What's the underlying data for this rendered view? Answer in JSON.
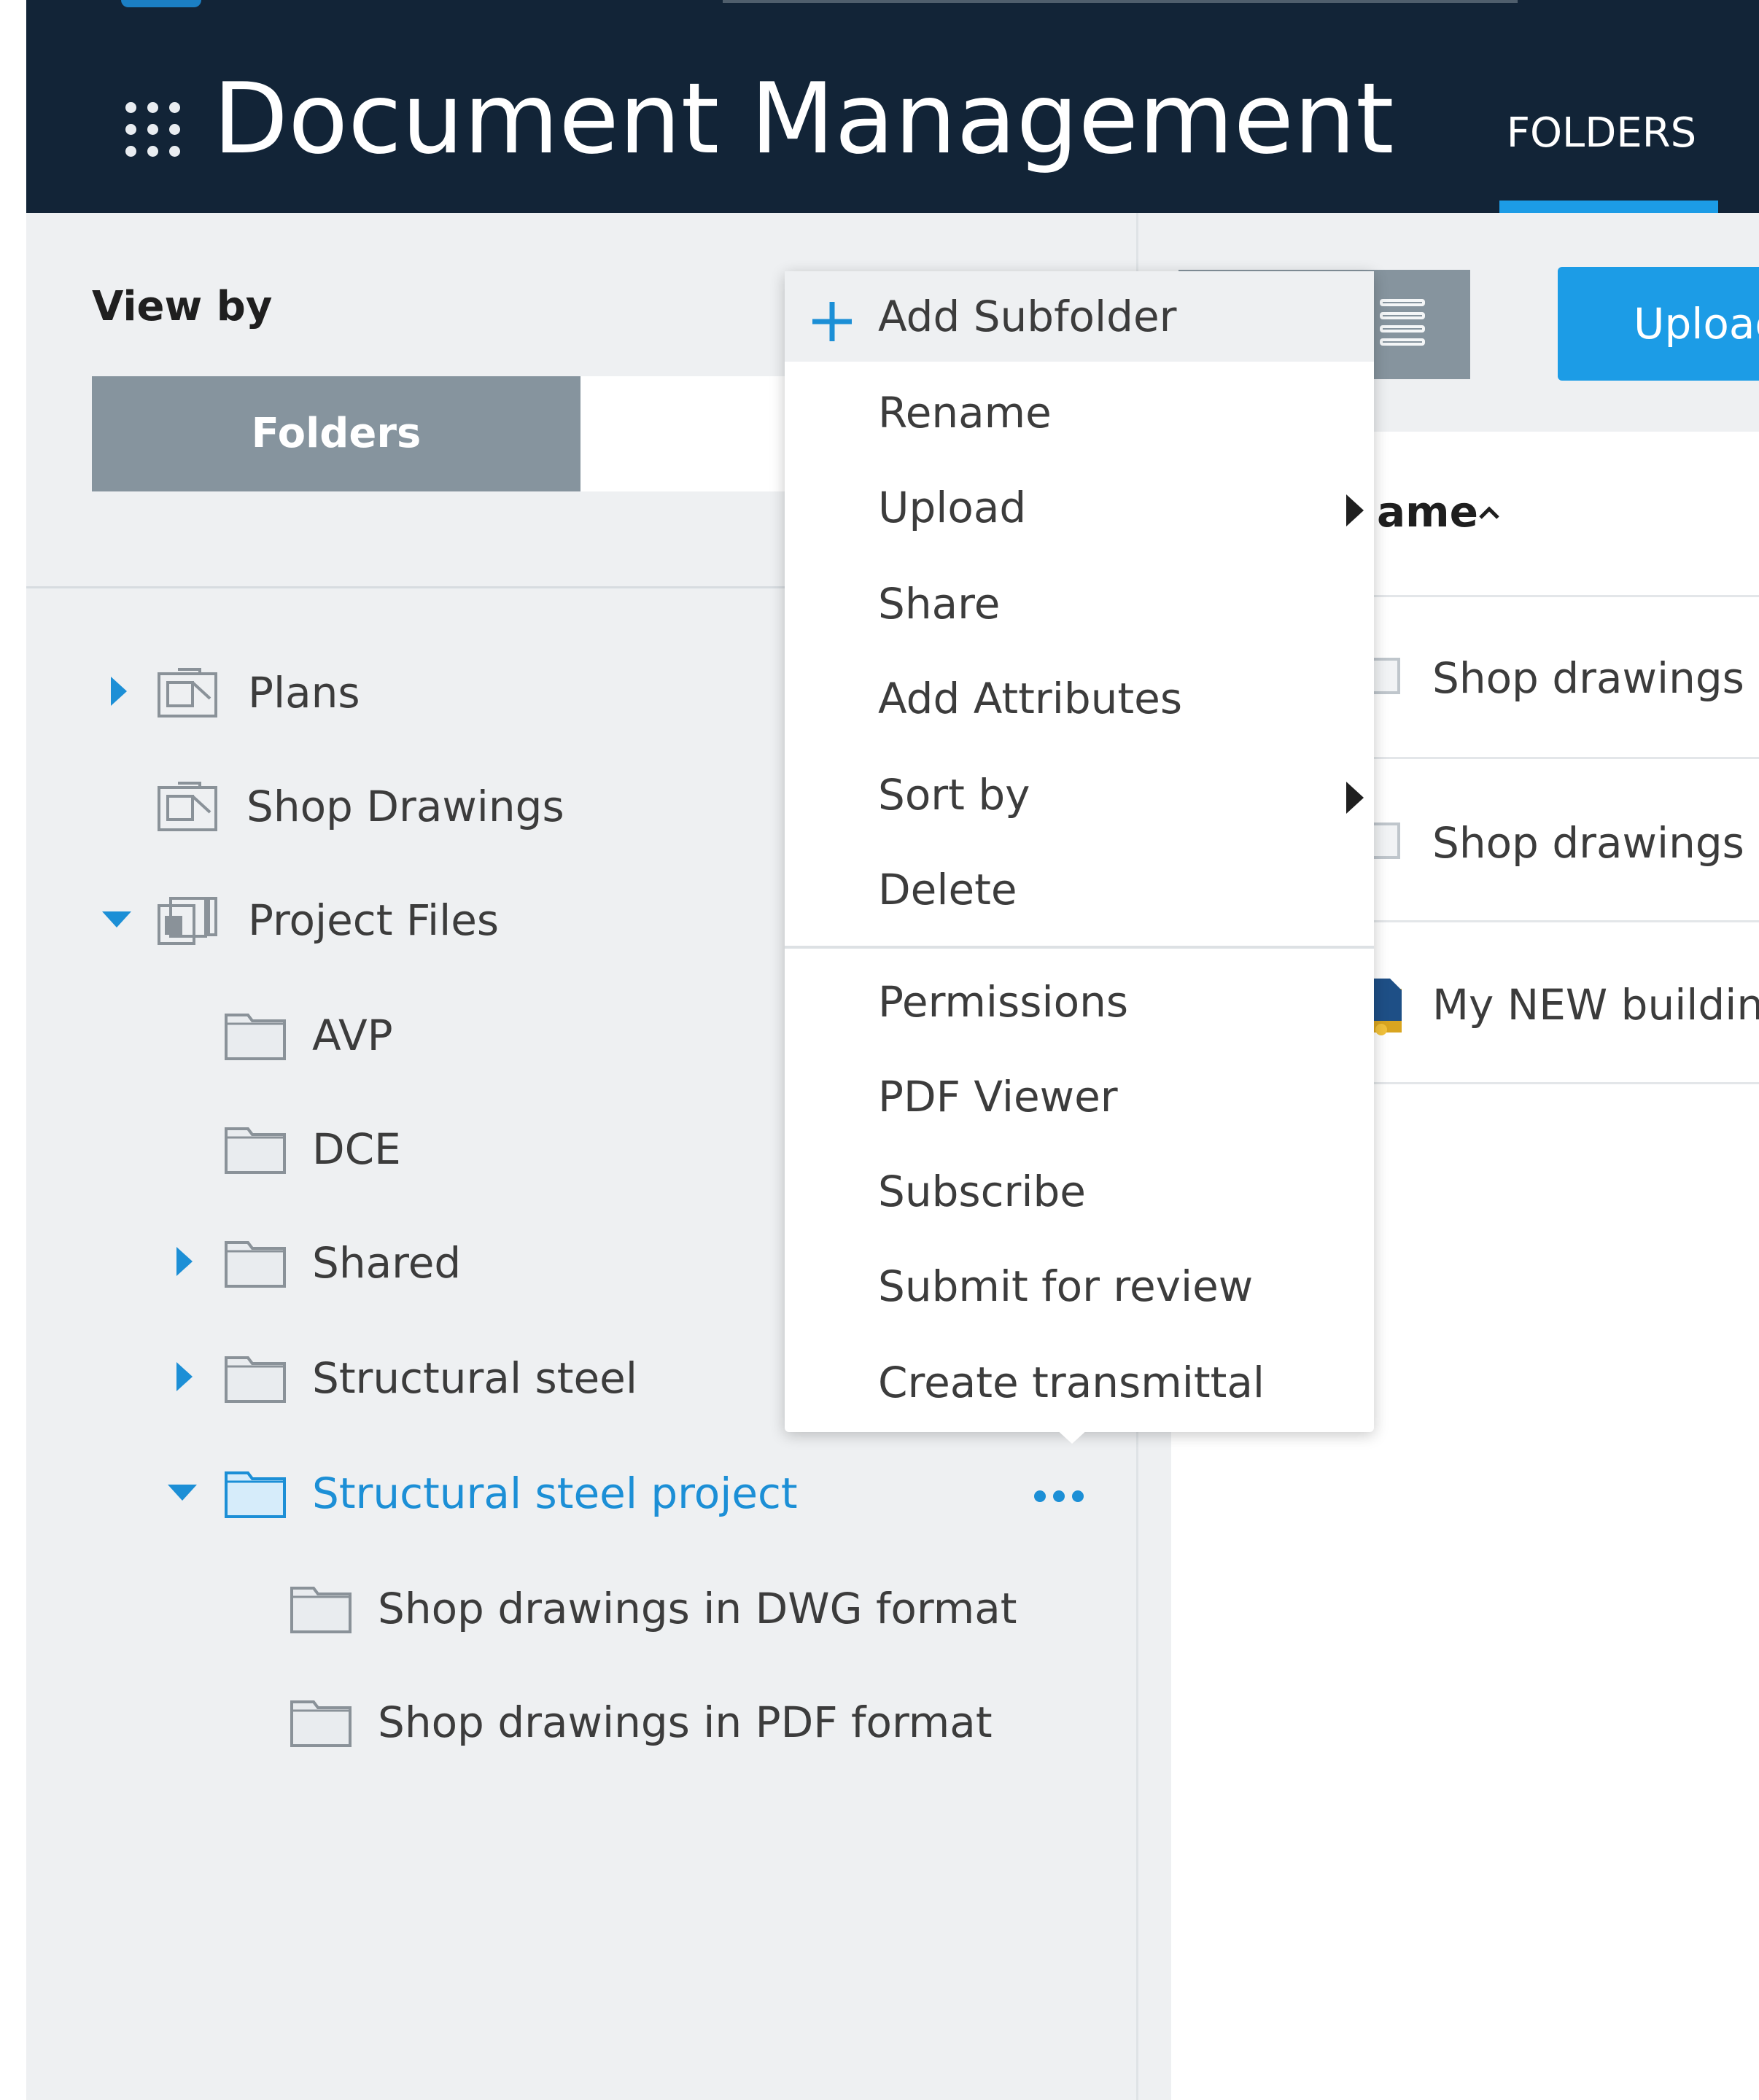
{
  "header": {
    "title": "Document Management",
    "nav_tab_folders": "FOLDERS"
  },
  "left_panel": {
    "view_by_label": "View by",
    "view_toggle_active": "Folders",
    "tree": [
      {
        "label": "Plans",
        "expanded": false,
        "has_children": true,
        "icon": "plans-folder-icon"
      },
      {
        "label": "Shop Drawings",
        "expanded": false,
        "has_children": false,
        "icon": "plans-folder-icon"
      },
      {
        "label": "Project Files",
        "expanded": true,
        "has_children": true,
        "icon": "project-files-folder-icon"
      },
      {
        "label": "AVP",
        "expanded": false,
        "has_children": false,
        "icon": "folder-icon"
      },
      {
        "label": "DCE",
        "expanded": false,
        "has_children": false,
        "icon": "folder-icon"
      },
      {
        "label": "Shared",
        "expanded": false,
        "has_children": true,
        "icon": "folder-icon"
      },
      {
        "label": "Structural steel",
        "expanded": false,
        "has_children": true,
        "icon": "folder-icon"
      },
      {
        "label": "Structural steel project",
        "expanded": true,
        "has_children": true,
        "selected": true,
        "icon": "folder-icon"
      },
      {
        "label": "Shop drawings in DWG format",
        "expanded": false,
        "has_children": false,
        "icon": "folder-icon"
      },
      {
        "label": "Shop drawings in PDF format",
        "expanded": false,
        "has_children": false,
        "icon": "folder-icon"
      }
    ]
  },
  "context_menu": {
    "items": [
      {
        "label": "Add Subfolder",
        "has_icon": true,
        "hover": true
      },
      {
        "label": "Rename"
      },
      {
        "label": "Upload",
        "submenu": true
      },
      {
        "label": "Share"
      },
      {
        "label": "Add Attributes"
      },
      {
        "label": "Sort by",
        "submenu": true
      },
      {
        "label": "Delete"
      },
      {
        "label": "Permissions"
      },
      {
        "label": "PDF Viewer"
      },
      {
        "label": "Subscribe"
      },
      {
        "label": "Submit for review"
      },
      {
        "label": "Create transmittal"
      }
    ]
  },
  "right_panel": {
    "upload_button": "Upload",
    "column_header": "ame",
    "rows": [
      {
        "name": "Shop drawings in"
      },
      {
        "name": "Shop drawings in"
      },
      {
        "name": "My NEW building."
      }
    ]
  },
  "colors": {
    "header_bg": "#122437",
    "accent": "#1c9ce6",
    "selected_text": "#1c8fd6",
    "toggle_active_bg": "#86949e",
    "panel_bg": "#eef0f2"
  }
}
